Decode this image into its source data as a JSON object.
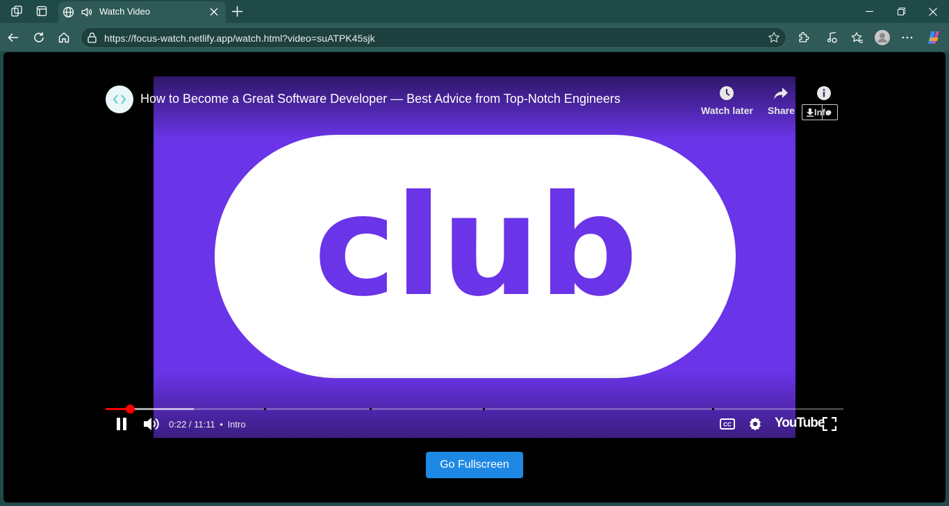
{
  "browser": {
    "tab": {
      "title": "Watch Video",
      "icons": [
        "globe-icon",
        "speaker-icon",
        "close-icon"
      ]
    },
    "url": "https://focus-watch.netlify.app/watch.html?video=suATPK45sjk",
    "window_controls": [
      "minimize-icon",
      "restore-icon",
      "close-icon"
    ]
  },
  "video": {
    "title": "How to Become a Great Software Developer — Best Advice from Top-Notch Engineers",
    "thumbnail_text": "club",
    "actions": {
      "watch_later": "Watch later",
      "share": "Share",
      "info": "Info"
    },
    "time": "0:22 / 11:11",
    "chapter_separator": "•",
    "chapter": "Intro",
    "progress_fraction": 0.033,
    "buffer_fraction": 0.12,
    "logo": "YouTube",
    "colors": {
      "brand_purple": "#6a34e8",
      "progress_red": "#ff0000"
    }
  },
  "page": {
    "fullscreen_button": "Go Fullscreen"
  }
}
